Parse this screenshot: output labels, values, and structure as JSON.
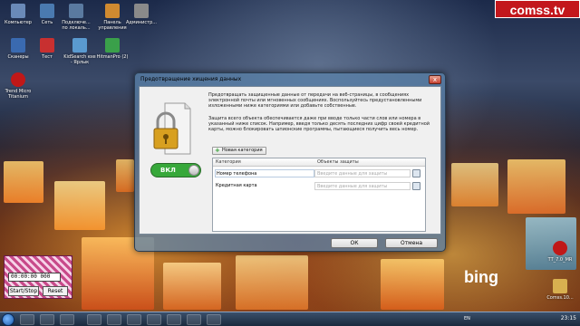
{
  "desktop": {
    "icons": [
      {
        "label": "Компьютер",
        "color": "#6a8ab8"
      },
      {
        "label": "Сеть",
        "color": "#4a7ab0"
      },
      {
        "label": "Подключе... по локаль...",
        "color": "#5a7aa0"
      },
      {
        "label": "Панель управления",
        "color": "#d08a30"
      },
      {
        "label": "Администр...",
        "color": "#8a8a8a"
      },
      {
        "label": "Сканеры",
        "color": "#3a6ab0"
      },
      {
        "label": "Тест",
        "color": "#c83030"
      },
      {
        "label": "KidSearch exe - Ярлык",
        "color": "#5a9ad0"
      },
      {
        "label": "HitmanPro (2)",
        "color": "#3aa04a"
      },
      {
        "label": "Trend Micro Titanium",
        "color": "#c01818"
      }
    ],
    "brand": "comss.tv",
    "bing": "bing",
    "right_labels": [
      "TT_7.0_MR",
      "Comss.10..."
    ]
  },
  "dialog": {
    "title": "Предотвращение хищения данных",
    "close_label": "x",
    "toggle_label": "ВКЛ",
    "toggle_on": true,
    "description_1": "Предотвращать защищенные данные от передачи на веб-страницы, в сообщениях электронной почты или мгновенных сообщениях. Воспользуйтесь предустановленными изложенными ниже категориями или добавьте собственные.",
    "description_2": "Защита всего объекта обеспечивается даже при вводе только части слов или номера в указанный ниже список. Например, введя только десять последних цифр своей кредитной карты, можно блокировать шпионские программы, пытающиеся получить весь номер.",
    "new_category_label": "Новая категория",
    "table": {
      "headers": [
        "Категория",
        "Объекты защиты"
      ],
      "rows": [
        {
          "category": "Номер телефона",
          "placeholder": "Введите данные для защиты"
        },
        {
          "category": "Кредитная карта",
          "placeholder": "Введите данные для защиты"
        }
      ]
    },
    "ok_label": "ОК",
    "cancel_label": "Отмена"
  },
  "gadget": {
    "time": "00:00:00 000",
    "start_stop": "Start/Stop",
    "reset": "Reset"
  },
  "taskbar": {
    "language": "EN",
    "clock": "23:15"
  }
}
